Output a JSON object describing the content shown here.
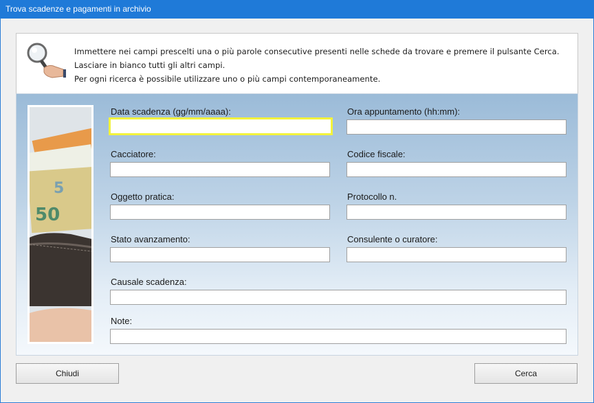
{
  "window": {
    "title": "Trova scadenze e pagamenti in archivio"
  },
  "info": {
    "icon": "magnifier-hand-icon",
    "lines": [
      "Immettere nei campi prescelti una o più parole consecutive presenti nelle schede da trovare e premere il pulsante Cerca.",
      "Lasciare in bianco tutti gli altri campi.",
      "Per ogni ricerca è possibile utilizzare uno o più campi contemporaneamente."
    ]
  },
  "fields": {
    "data_scadenza": {
      "label": "Data scadenza (gg/mm/aaaa):",
      "value": ""
    },
    "ora_appuntamento": {
      "label": "Ora appuntamento (hh:mm):",
      "value": ""
    },
    "cacciatore": {
      "label": "Cacciatore:",
      "value": ""
    },
    "codice_fiscale": {
      "label": "Codice fiscale:",
      "value": ""
    },
    "oggetto_pratica": {
      "label": "Oggetto pratica:",
      "value": ""
    },
    "protocollo": {
      "label": "Protocollo n.",
      "value": ""
    },
    "stato_avanzamento": {
      "label": "Stato avanzamento:",
      "value": ""
    },
    "consulente": {
      "label": "Consulente o curatore:",
      "value": ""
    },
    "causale": {
      "label": "Causale scadenza:",
      "value": ""
    },
    "note": {
      "label": "Note:",
      "value": ""
    }
  },
  "buttons": {
    "close": "Chiudi",
    "search": "Cerca"
  },
  "colors": {
    "titlebar": "#1f7ad8",
    "focus_border": "#f3f33c",
    "panel_top": "#9bbbd8",
    "panel_bottom": "#f4f8fc"
  }
}
